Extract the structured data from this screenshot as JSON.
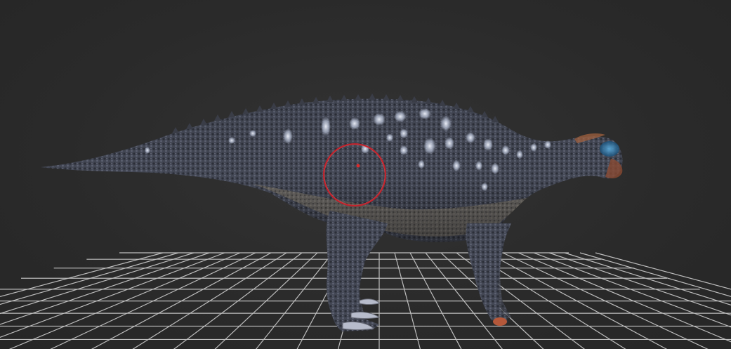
{
  "viewport": {
    "background_color": "#2b2b2b",
    "grid_color": "#d9d9d9",
    "grid_visible": true
  },
  "model": {
    "subject": "dinosaur",
    "skin_dark": "#3a3d47",
    "skin_mid": "#5a5f6e",
    "spot_color": "#e8eef8",
    "belly_color": "#7a7266"
  },
  "gizmo": {
    "color": "#c0202a",
    "shape": "circle-gizmo-icon"
  }
}
